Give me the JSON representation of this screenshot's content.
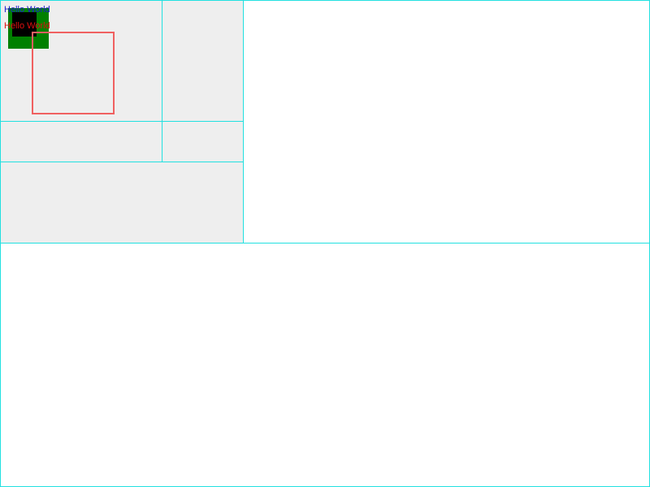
{
  "labels": {
    "blue_text": "Hello World",
    "red_text": "Hello World"
  },
  "colors": {
    "frame_border": "#22e0e0",
    "panel_fill": "#eeeeee",
    "outer_square": "#008000",
    "inner_square": "#000000",
    "outline_square": "#f06060",
    "blue_text": "#1a1ad0",
    "red_text": "#e01010"
  }
}
